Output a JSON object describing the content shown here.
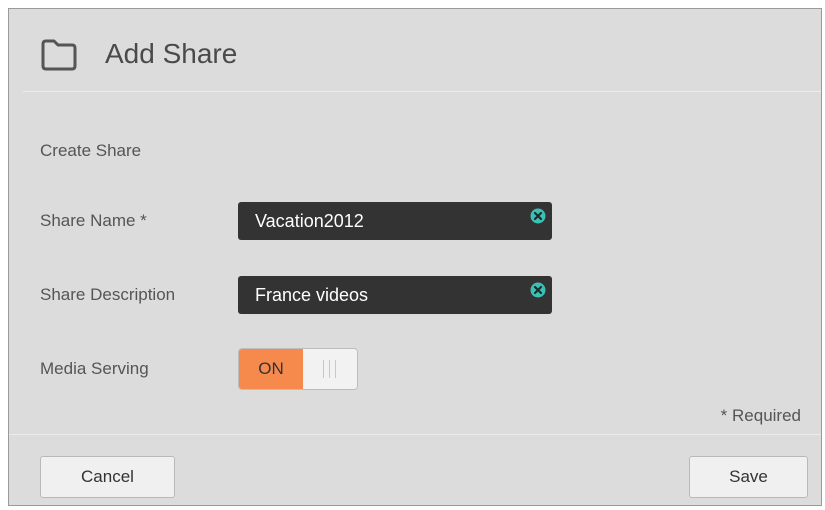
{
  "dialog": {
    "title": "Add Share",
    "title_icon": "folder-icon"
  },
  "form": {
    "section_label": "Create Share",
    "share_name": {
      "label": "Share Name *",
      "value": "Vacation2012",
      "clear_icon": "clear-circle-x-icon"
    },
    "share_description": {
      "label": "Share Description",
      "value": "France videos",
      "clear_icon": "clear-circle-x-icon"
    },
    "media_serving": {
      "label": "Media Serving",
      "state_label": "ON",
      "enabled": true
    },
    "required_note": "* Required"
  },
  "footer": {
    "cancel_label": "Cancel",
    "save_label": "Save"
  },
  "colors": {
    "dialog_background": "#dcdcdc",
    "input_background": "#333333",
    "toggle_on": "#f68a4d",
    "clear_icon": "#3cc0b4"
  }
}
